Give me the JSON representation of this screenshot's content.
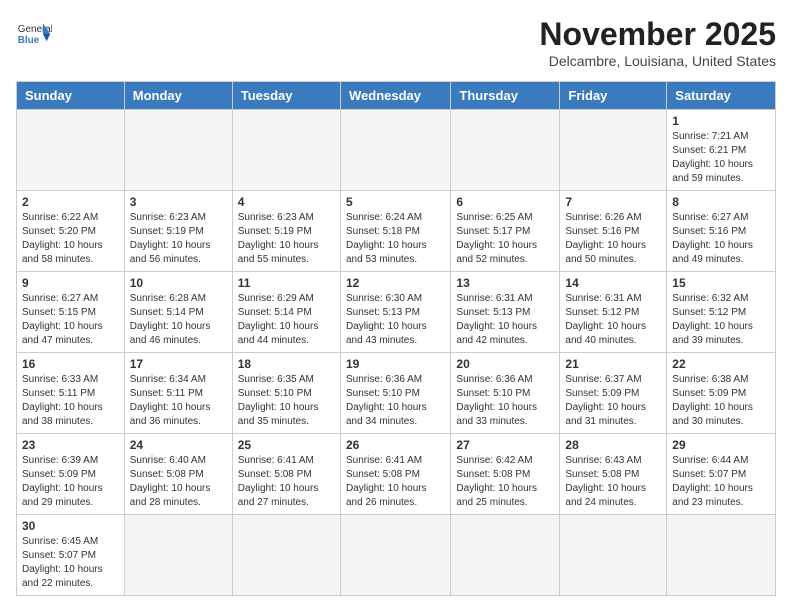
{
  "header": {
    "logo_general": "General",
    "logo_blue": "Blue",
    "month_title": "November 2025",
    "location": "Delcambre, Louisiana, United States"
  },
  "days_of_week": [
    "Sunday",
    "Monday",
    "Tuesday",
    "Wednesday",
    "Thursday",
    "Friday",
    "Saturday"
  ],
  "weeks": [
    [
      {
        "day": "",
        "info": ""
      },
      {
        "day": "",
        "info": ""
      },
      {
        "day": "",
        "info": ""
      },
      {
        "day": "",
        "info": ""
      },
      {
        "day": "",
        "info": ""
      },
      {
        "day": "",
        "info": ""
      },
      {
        "day": "1",
        "info": "Sunrise: 7:21 AM\nSunset: 6:21 PM\nDaylight: 10 hours\nand 59 minutes."
      }
    ],
    [
      {
        "day": "2",
        "info": "Sunrise: 6:22 AM\nSunset: 5:20 PM\nDaylight: 10 hours\nand 58 minutes."
      },
      {
        "day": "3",
        "info": "Sunrise: 6:23 AM\nSunset: 5:19 PM\nDaylight: 10 hours\nand 56 minutes."
      },
      {
        "day": "4",
        "info": "Sunrise: 6:23 AM\nSunset: 5:19 PM\nDaylight: 10 hours\nand 55 minutes."
      },
      {
        "day": "5",
        "info": "Sunrise: 6:24 AM\nSunset: 5:18 PM\nDaylight: 10 hours\nand 53 minutes."
      },
      {
        "day": "6",
        "info": "Sunrise: 6:25 AM\nSunset: 5:17 PM\nDaylight: 10 hours\nand 52 minutes."
      },
      {
        "day": "7",
        "info": "Sunrise: 6:26 AM\nSunset: 5:16 PM\nDaylight: 10 hours\nand 50 minutes."
      },
      {
        "day": "8",
        "info": "Sunrise: 6:27 AM\nSunset: 5:16 PM\nDaylight: 10 hours\nand 49 minutes."
      }
    ],
    [
      {
        "day": "9",
        "info": "Sunrise: 6:27 AM\nSunset: 5:15 PM\nDaylight: 10 hours\nand 47 minutes."
      },
      {
        "day": "10",
        "info": "Sunrise: 6:28 AM\nSunset: 5:14 PM\nDaylight: 10 hours\nand 46 minutes."
      },
      {
        "day": "11",
        "info": "Sunrise: 6:29 AM\nSunset: 5:14 PM\nDaylight: 10 hours\nand 44 minutes."
      },
      {
        "day": "12",
        "info": "Sunrise: 6:30 AM\nSunset: 5:13 PM\nDaylight: 10 hours\nand 43 minutes."
      },
      {
        "day": "13",
        "info": "Sunrise: 6:31 AM\nSunset: 5:13 PM\nDaylight: 10 hours\nand 42 minutes."
      },
      {
        "day": "14",
        "info": "Sunrise: 6:31 AM\nSunset: 5:12 PM\nDaylight: 10 hours\nand 40 minutes."
      },
      {
        "day": "15",
        "info": "Sunrise: 6:32 AM\nSunset: 5:12 PM\nDaylight: 10 hours\nand 39 minutes."
      }
    ],
    [
      {
        "day": "16",
        "info": "Sunrise: 6:33 AM\nSunset: 5:11 PM\nDaylight: 10 hours\nand 38 minutes."
      },
      {
        "day": "17",
        "info": "Sunrise: 6:34 AM\nSunset: 5:11 PM\nDaylight: 10 hours\nand 36 minutes."
      },
      {
        "day": "18",
        "info": "Sunrise: 6:35 AM\nSunset: 5:10 PM\nDaylight: 10 hours\nand 35 minutes."
      },
      {
        "day": "19",
        "info": "Sunrise: 6:36 AM\nSunset: 5:10 PM\nDaylight: 10 hours\nand 34 minutes."
      },
      {
        "day": "20",
        "info": "Sunrise: 6:36 AM\nSunset: 5:10 PM\nDaylight: 10 hours\nand 33 minutes."
      },
      {
        "day": "21",
        "info": "Sunrise: 6:37 AM\nSunset: 5:09 PM\nDaylight: 10 hours\nand 31 minutes."
      },
      {
        "day": "22",
        "info": "Sunrise: 6:38 AM\nSunset: 5:09 PM\nDaylight: 10 hours\nand 30 minutes."
      }
    ],
    [
      {
        "day": "23",
        "info": "Sunrise: 6:39 AM\nSunset: 5:09 PM\nDaylight: 10 hours\nand 29 minutes."
      },
      {
        "day": "24",
        "info": "Sunrise: 6:40 AM\nSunset: 5:08 PM\nDaylight: 10 hours\nand 28 minutes."
      },
      {
        "day": "25",
        "info": "Sunrise: 6:41 AM\nSunset: 5:08 PM\nDaylight: 10 hours\nand 27 minutes."
      },
      {
        "day": "26",
        "info": "Sunrise: 6:41 AM\nSunset: 5:08 PM\nDaylight: 10 hours\nand 26 minutes."
      },
      {
        "day": "27",
        "info": "Sunrise: 6:42 AM\nSunset: 5:08 PM\nDaylight: 10 hours\nand 25 minutes."
      },
      {
        "day": "28",
        "info": "Sunrise: 6:43 AM\nSunset: 5:08 PM\nDaylight: 10 hours\nand 24 minutes."
      },
      {
        "day": "29",
        "info": "Sunrise: 6:44 AM\nSunset: 5:07 PM\nDaylight: 10 hours\nand 23 minutes."
      }
    ],
    [
      {
        "day": "30",
        "info": "Sunrise: 6:45 AM\nSunset: 5:07 PM\nDaylight: 10 hours\nand 22 minutes."
      },
      {
        "day": "",
        "info": ""
      },
      {
        "day": "",
        "info": ""
      },
      {
        "day": "",
        "info": ""
      },
      {
        "day": "",
        "info": ""
      },
      {
        "day": "",
        "info": ""
      },
      {
        "day": "",
        "info": ""
      }
    ]
  ]
}
